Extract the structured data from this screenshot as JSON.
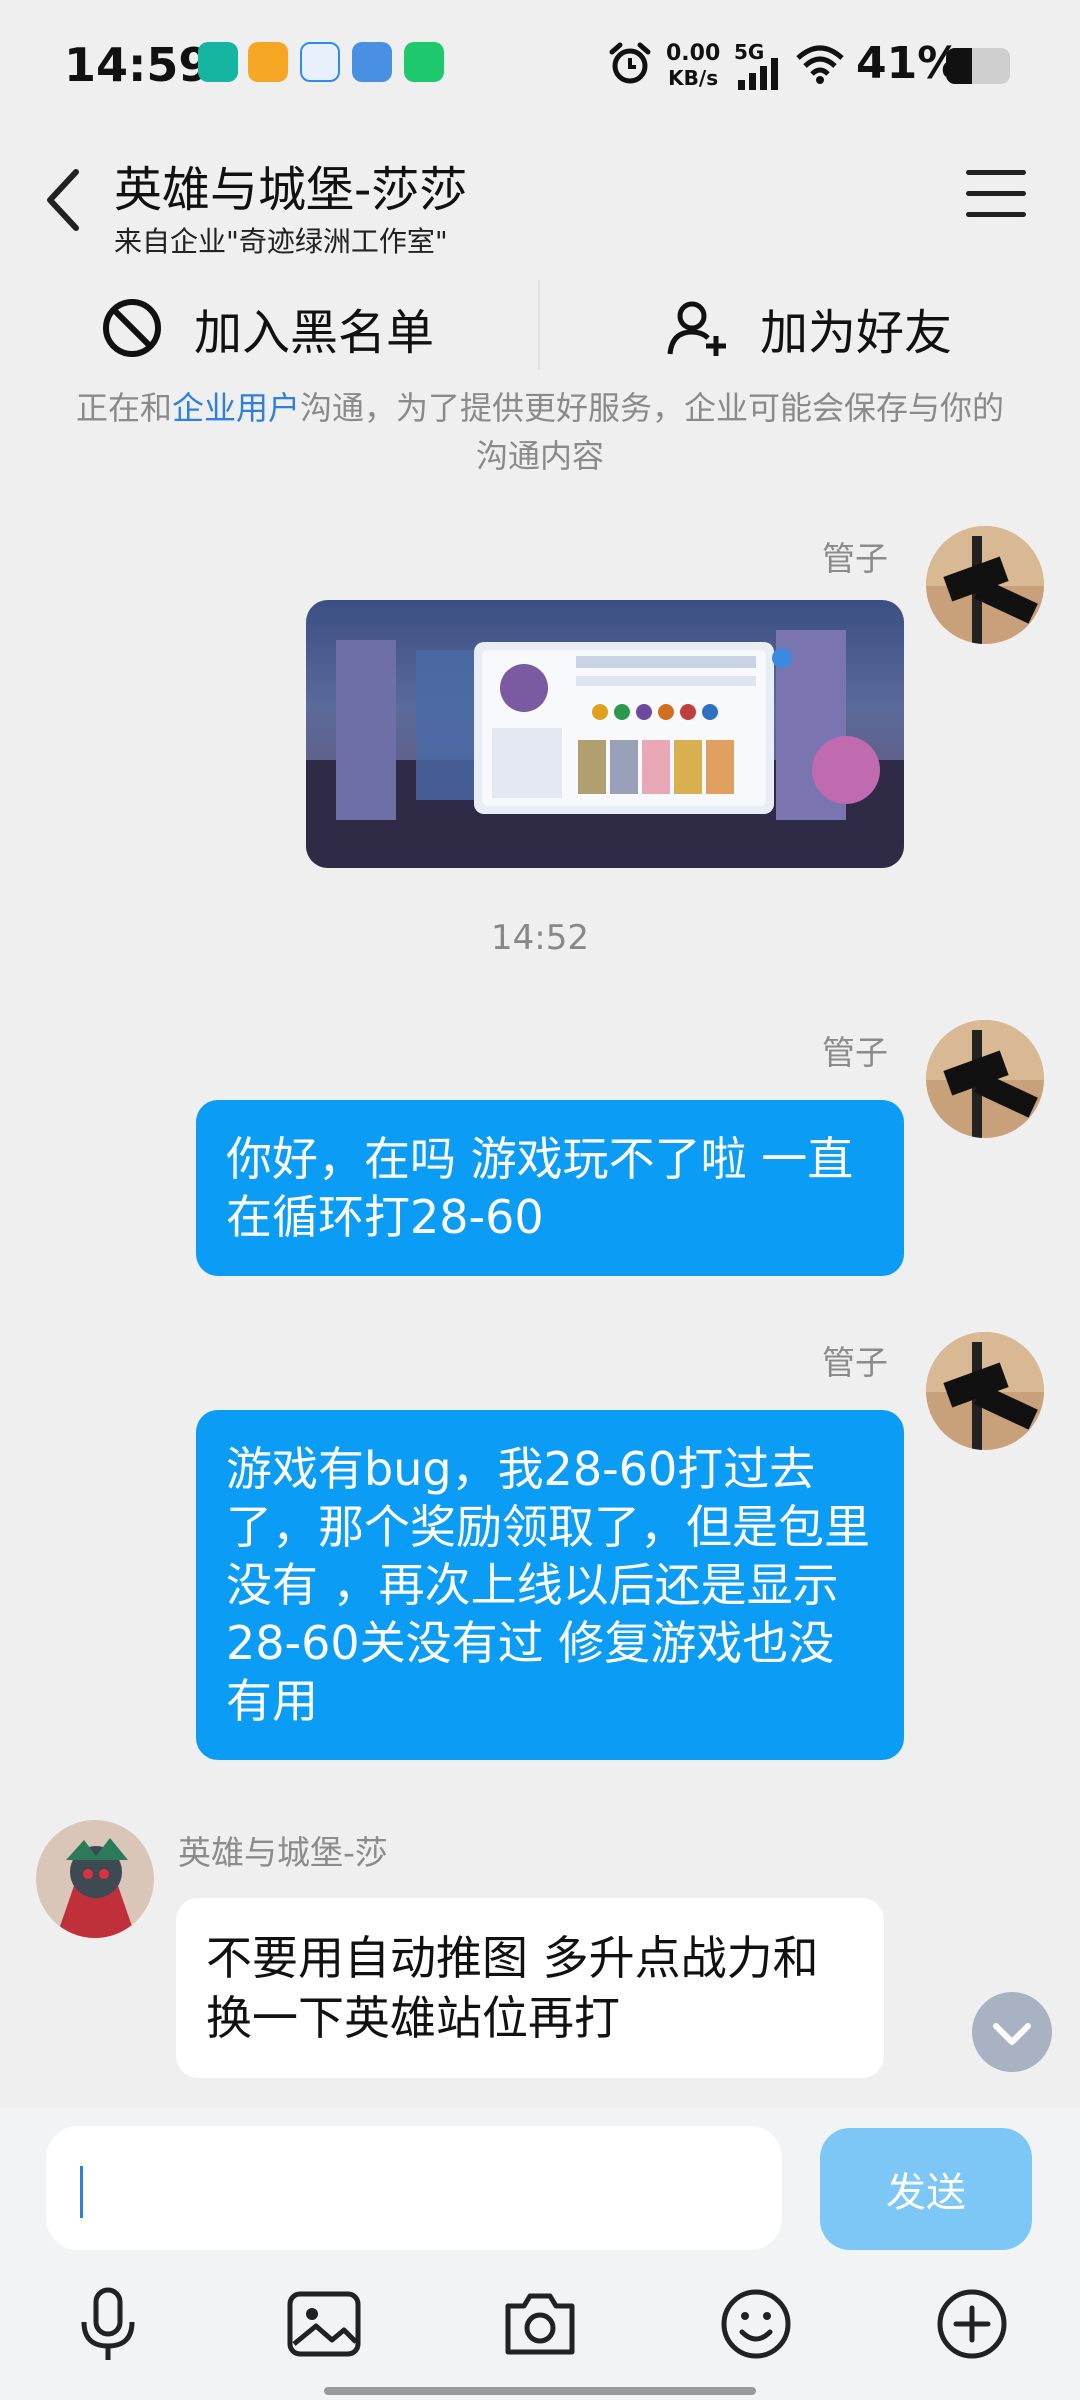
{
  "status_bar": {
    "time": "14:59",
    "net_speed_value": "0.00",
    "net_speed_unit": "KB/s",
    "network": "5G",
    "battery": "41%",
    "battery_level": 0.41
  },
  "header": {
    "title": "英雄与城堡-莎莎",
    "subtitle": "来自企业\"奇迹绿洲工作室\""
  },
  "actions": {
    "block_label": "加入黑名单",
    "add_friend_label": "加为好友"
  },
  "notice": {
    "prefix": "正在和",
    "highlight": "企业用户",
    "suffix": "沟通，为了提供更好服务，企业可能会保存与你的沟通内容"
  },
  "messages": [
    {
      "sender": "管子"
    },
    {
      "time": "14:52"
    },
    {
      "sender": "管子",
      "text": "你好，在吗 游戏玩不了啦 一直在循环打28-60"
    },
    {
      "sender": "管子",
      "text": "游戏有bug，我28-60打过去了，那个奖励领取了，但是包里没有 ，再次上线以后还是显示28-60关没有过 修复游戏也没有用"
    },
    {
      "sender": "英雄与城堡-莎",
      "text": "不要用自动推图 多升点战力和换一下英雄站位再打"
    }
  ],
  "composer": {
    "send_label": "发送"
  },
  "colors": {
    "bubble_me": "#0b9cf5",
    "link": "#2f7fe0",
    "send_button": "#7cc7f6"
  }
}
